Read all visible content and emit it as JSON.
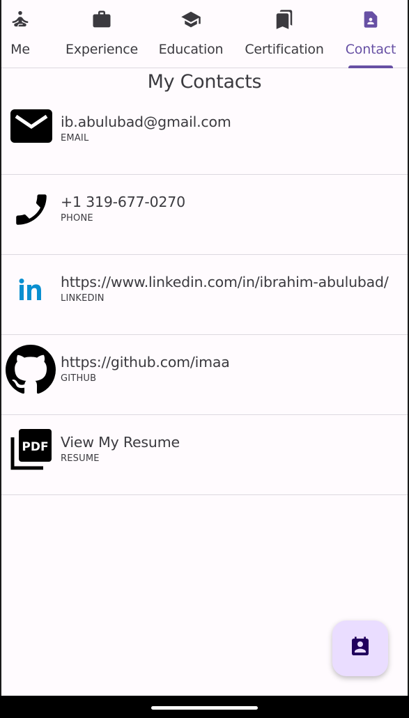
{
  "tabs": [
    {
      "label": "Me",
      "icon": "person-meditation-icon",
      "active": false
    },
    {
      "label": "Experience",
      "icon": "briefcase-icon",
      "active": false
    },
    {
      "label": "Education",
      "icon": "graduation-cap-icon",
      "active": false
    },
    {
      "label": "Certification",
      "icon": "bookmarks-icon",
      "active": false
    },
    {
      "label": "Contact",
      "icon": "contact-page-icon",
      "active": true
    }
  ],
  "title": "My Contacts",
  "contacts": [
    {
      "value": "ib.abulubad@gmail.com",
      "type": "EMAIL",
      "icon": "mail-icon"
    },
    {
      "value": "+1 319-677-0270",
      "type": "PHONE",
      "icon": "phone-icon"
    },
    {
      "value": "https://www.linkedin.com/in/ibrahim-abulubad/",
      "type": "LINKEDIN",
      "icon": "linkedin-icon"
    },
    {
      "value": "https://github.com/imaa",
      "type": "GITHUB",
      "icon": "github-icon"
    },
    {
      "value": "View My Resume",
      "type": "RESUME",
      "icon": "pdf-icon"
    }
  ],
  "fab": {
    "icon": "contact-calendar-icon"
  },
  "colors": {
    "accent": "#6750a4",
    "fab_bg": "#eaddff",
    "fab_icon": "#21005d",
    "linkedin": "#0a8fd0",
    "background": "#fffbfe"
  }
}
